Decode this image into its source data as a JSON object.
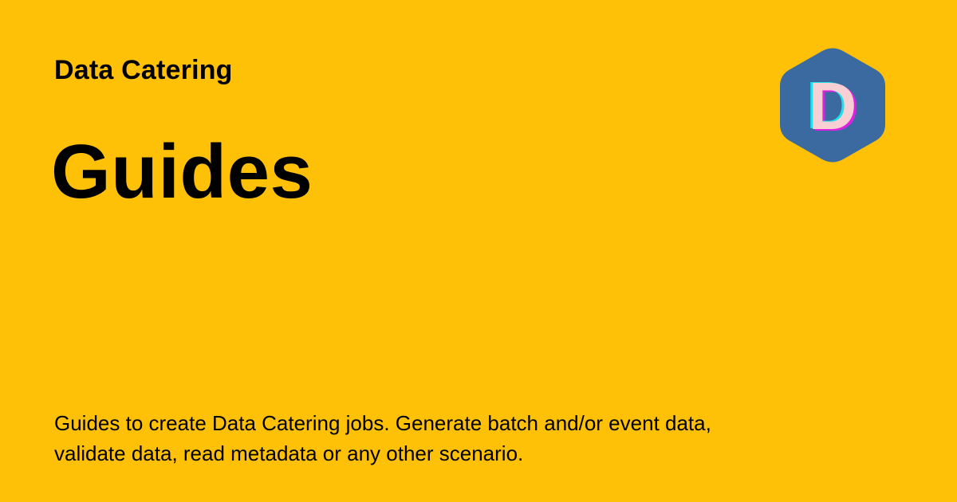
{
  "site": {
    "name": "Data Catering"
  },
  "page": {
    "title": "Guides",
    "description": "Guides to create Data Catering jobs. Generate batch and/or event data, validate data, read metadata or any other scenario."
  },
  "logo": {
    "icon": "hexagon-d-logo-icon",
    "letter": "D",
    "colors": {
      "hexagon": "#3A6AA0",
      "letter_fill": "#F8CFD3",
      "letter_shadow_magenta": "#E020E0",
      "letter_shadow_cyan": "#20E0E8"
    }
  },
  "colors": {
    "background": "#FFC107",
    "text": "#000000"
  }
}
